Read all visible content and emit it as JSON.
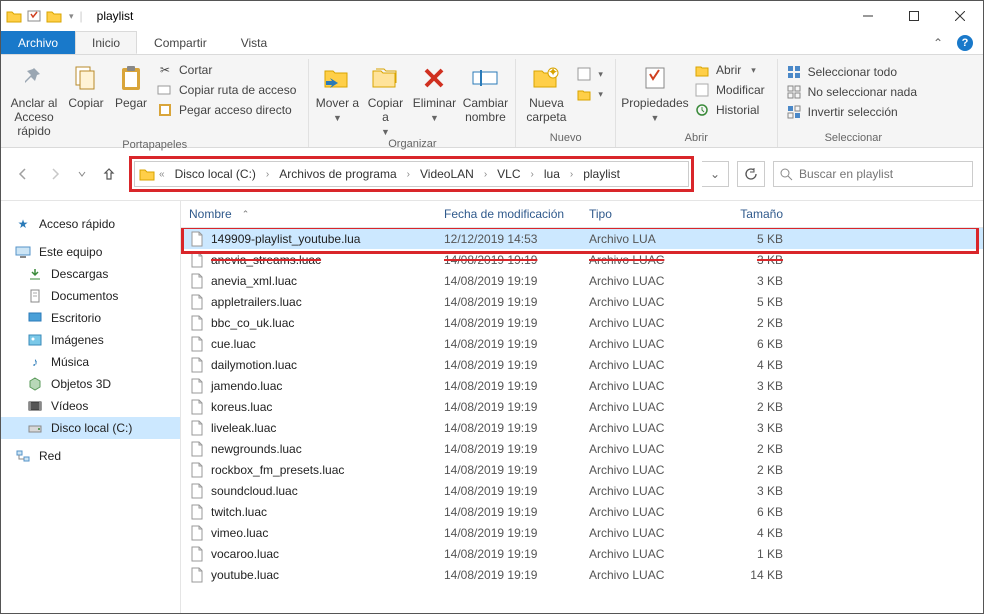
{
  "window": {
    "title": "playlist"
  },
  "tabs": {
    "file": "Archivo",
    "home": "Inicio",
    "share": "Compartir",
    "view": "Vista"
  },
  "ribbon": {
    "groups": {
      "clipboard": {
        "label": "Portapapeles",
        "pin": "Anclar al Acceso rápido",
        "copy": "Copiar",
        "paste": "Pegar",
        "cut": "Cortar",
        "copyPath": "Copiar ruta de acceso",
        "pasteShortcut": "Pegar acceso directo"
      },
      "organize": {
        "label": "Organizar",
        "moveTo": "Mover a",
        "copyTo": "Copiar a",
        "delete": "Eliminar",
        "rename": "Cambiar nombre"
      },
      "new": {
        "label": "Nuevo",
        "newFolder": "Nueva carpeta"
      },
      "open": {
        "label": "Abrir",
        "properties": "Propiedades",
        "open": "Abrir",
        "edit": "Modificar",
        "history": "Historial"
      },
      "select": {
        "label": "Seleccionar",
        "selectAll": "Seleccionar todo",
        "selectNone": "No seleccionar nada",
        "invert": "Invertir selección"
      }
    }
  },
  "breadcrumbs": [
    "Disco local (C:)",
    "Archivos de programa",
    "VideoLAN",
    "VLC",
    "lua",
    "playlist"
  ],
  "search": {
    "placeholder": "Buscar en playlist"
  },
  "sidebar": {
    "quickAccess": "Acceso rápido",
    "thisPC": "Este equipo",
    "downloads": "Descargas",
    "documents": "Documentos",
    "desktop": "Escritorio",
    "pictures": "Imágenes",
    "music": "Música",
    "objects3d": "Objetos 3D",
    "videos": "Vídeos",
    "localDisk": "Disco local (C:)",
    "network": "Red"
  },
  "columns": {
    "name": "Nombre",
    "date": "Fecha de modificación",
    "type": "Tipo",
    "size": "Tamaño"
  },
  "files": [
    {
      "name": "149909-playlist_youtube.lua",
      "date": "12/12/2019 14:53",
      "type": "Archivo LUA",
      "size": "5 KB",
      "selected": true
    },
    {
      "name": "anevia_streams.luac",
      "date": "14/08/2019 19:19",
      "type": "Archivo LUAC",
      "size": "3 KB",
      "strike": true
    },
    {
      "name": "anevia_xml.luac",
      "date": "14/08/2019 19:19",
      "type": "Archivo LUAC",
      "size": "3 KB"
    },
    {
      "name": "appletrailers.luac",
      "date": "14/08/2019 19:19",
      "type": "Archivo LUAC",
      "size": "5 KB"
    },
    {
      "name": "bbc_co_uk.luac",
      "date": "14/08/2019 19:19",
      "type": "Archivo LUAC",
      "size": "2 KB"
    },
    {
      "name": "cue.luac",
      "date": "14/08/2019 19:19",
      "type": "Archivo LUAC",
      "size": "6 KB"
    },
    {
      "name": "dailymotion.luac",
      "date": "14/08/2019 19:19",
      "type": "Archivo LUAC",
      "size": "4 KB"
    },
    {
      "name": "jamendo.luac",
      "date": "14/08/2019 19:19",
      "type": "Archivo LUAC",
      "size": "3 KB"
    },
    {
      "name": "koreus.luac",
      "date": "14/08/2019 19:19",
      "type": "Archivo LUAC",
      "size": "2 KB"
    },
    {
      "name": "liveleak.luac",
      "date": "14/08/2019 19:19",
      "type": "Archivo LUAC",
      "size": "3 KB"
    },
    {
      "name": "newgrounds.luac",
      "date": "14/08/2019 19:19",
      "type": "Archivo LUAC",
      "size": "2 KB"
    },
    {
      "name": "rockbox_fm_presets.luac",
      "date": "14/08/2019 19:19",
      "type": "Archivo LUAC",
      "size": "2 KB"
    },
    {
      "name": "soundcloud.luac",
      "date": "14/08/2019 19:19",
      "type": "Archivo LUAC",
      "size": "3 KB"
    },
    {
      "name": "twitch.luac",
      "date": "14/08/2019 19:19",
      "type": "Archivo LUAC",
      "size": "6 KB"
    },
    {
      "name": "vimeo.luac",
      "date": "14/08/2019 19:19",
      "type": "Archivo LUAC",
      "size": "4 KB"
    },
    {
      "name": "vocaroo.luac",
      "date": "14/08/2019 19:19",
      "type": "Archivo LUAC",
      "size": "1 KB"
    },
    {
      "name": "youtube.luac",
      "date": "14/08/2019 19:19",
      "type": "Archivo LUAC",
      "size": "14 KB"
    }
  ]
}
